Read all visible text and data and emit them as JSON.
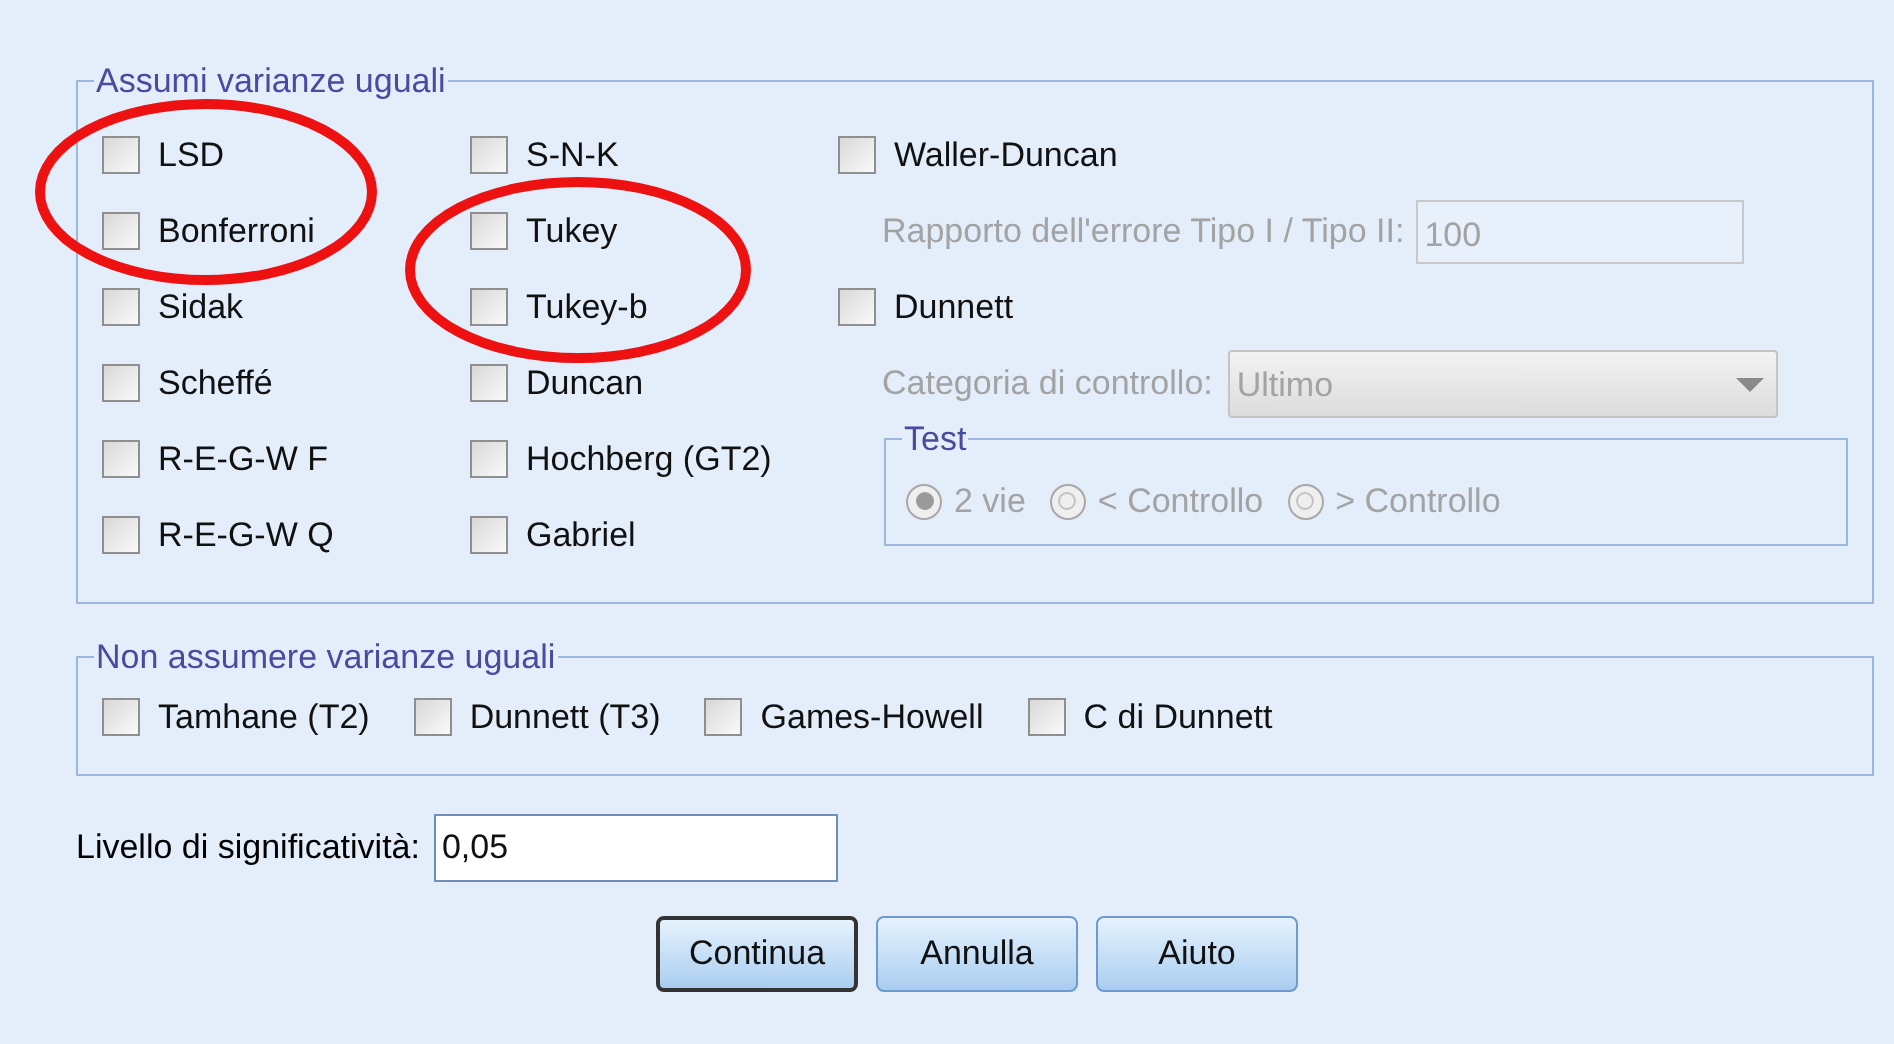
{
  "equal_variances": {
    "title": "Assumi varianze uguali",
    "column_1": [
      {
        "label": "LSD",
        "checked": false
      },
      {
        "label": "Bonferroni",
        "checked": false
      },
      {
        "label": "Sidak",
        "checked": false
      },
      {
        "label": "Scheffé",
        "checked": false
      },
      {
        "label": "R-E-G-W F",
        "checked": false
      },
      {
        "label": "R-E-G-W Q",
        "checked": false
      }
    ],
    "column_2": [
      {
        "label": "S-N-K",
        "checked": false
      },
      {
        "label": "Tukey",
        "checked": false
      },
      {
        "label": "Tukey-b",
        "checked": false
      },
      {
        "label": "Duncan",
        "checked": false
      },
      {
        "label": "Hochberg (GT2)",
        "checked": false
      },
      {
        "label": "Gabriel",
        "checked": false
      }
    ],
    "waller_duncan": {
      "label": "Waller-Duncan",
      "checked": false
    },
    "ratio": {
      "label": "Rapporto dell'errore Tipo I / Tipo II:",
      "value": "100",
      "disabled": true
    },
    "dunnett": {
      "label": "Dunnett",
      "checked": false
    },
    "control_category": {
      "label": "Categoria di controllo:",
      "value": "Ultimo",
      "disabled": true
    },
    "test": {
      "title": "Test",
      "disabled": true,
      "options": [
        {
          "label": "2 vie",
          "selected": true
        },
        {
          "label": "< Controllo",
          "selected": false
        },
        {
          "label": "> Controllo",
          "selected": false
        }
      ]
    }
  },
  "unequal_variances": {
    "title": "Non assumere varianze uguali",
    "items": [
      {
        "label": "Tamhane (T2)",
        "checked": false
      },
      {
        "label": "Dunnett (T3)",
        "checked": false
      },
      {
        "label": "Games-Howell",
        "checked": false
      },
      {
        "label": "C di Dunnett",
        "checked": false
      }
    ]
  },
  "significance": {
    "label": "Livello di significatività:",
    "value": "0,05"
  },
  "buttons": [
    {
      "label": "Continua",
      "selected": true
    },
    {
      "label": "Annulla",
      "selected": false
    },
    {
      "label": "Aiuto",
      "selected": false
    }
  ]
}
